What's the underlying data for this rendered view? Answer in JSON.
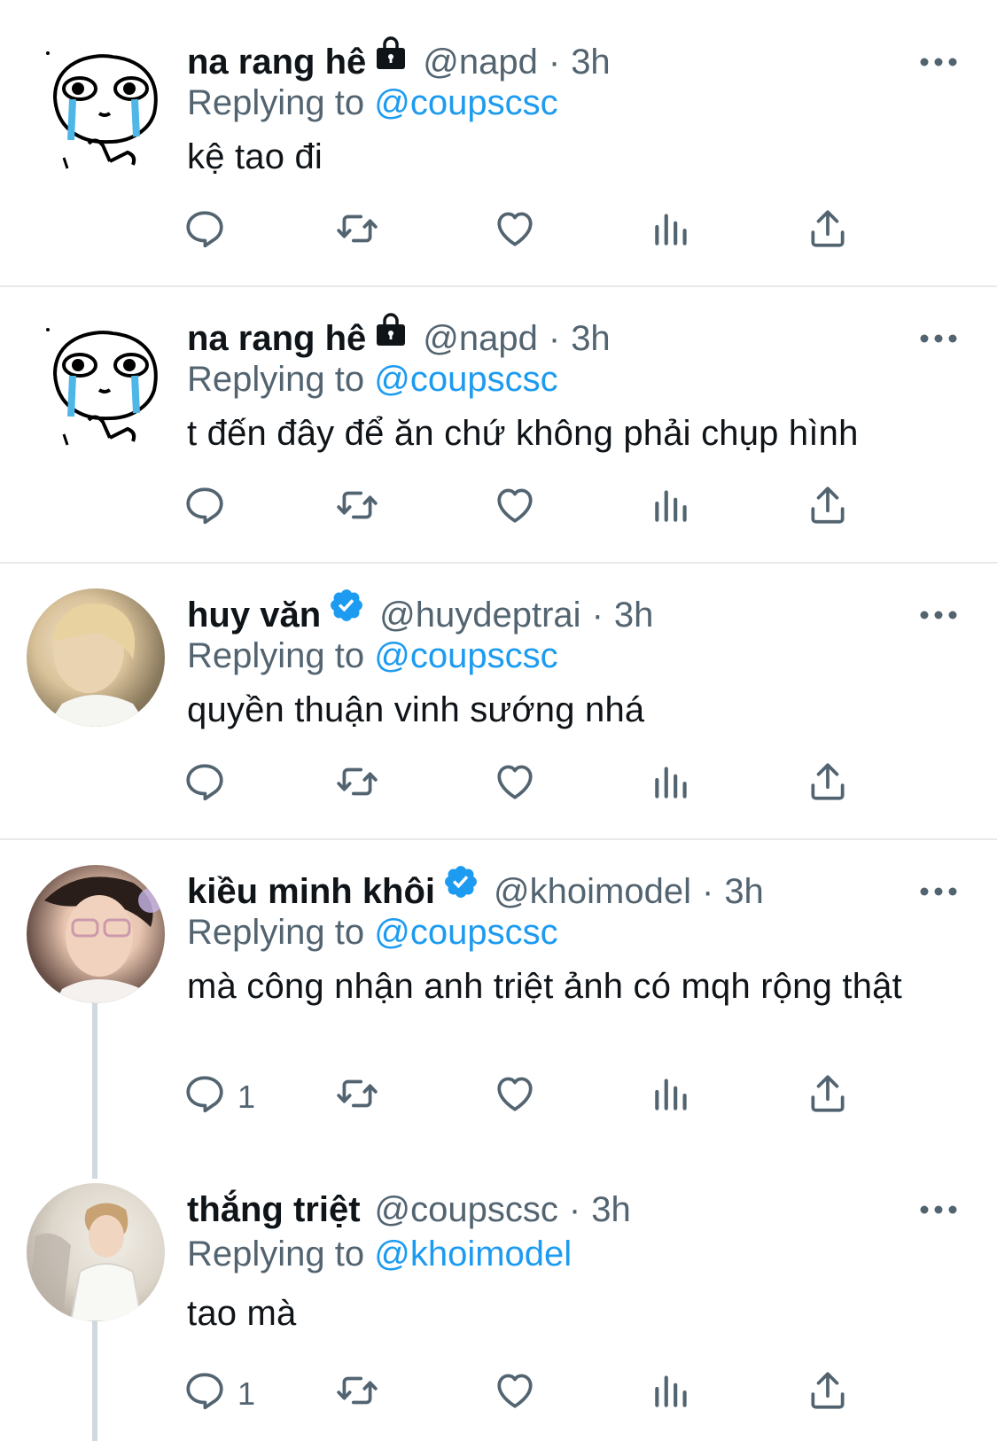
{
  "reply_prefix": "Replying to",
  "colors": {
    "accent": "#1d9bf0",
    "muted": "#536471",
    "text": "#0f1419",
    "verified": "#1d9bf0",
    "divider": "#e6e9ec"
  },
  "action_icons": [
    "reply-icon",
    "retweet-icon",
    "like-icon",
    "analytics-icon",
    "share-icon"
  ],
  "tweets": [
    {
      "name": "na rang hê",
      "badge": "lock-icon",
      "handle": "@napd",
      "sep": "·",
      "time": "3h",
      "reply_to": "@coupscsc",
      "text": "kệ tao đi",
      "reply_count": ""
    },
    {
      "name": "na rang hê",
      "badge": "lock-icon",
      "handle": "@napd",
      "sep": "·",
      "time": "3h",
      "reply_to": "@coupscsc",
      "text": "t đến đây để ăn chứ không phải chụp hình",
      "reply_count": ""
    },
    {
      "name": "huy văn",
      "badge": "verified-icon",
      "handle": "@huydeptrai",
      "sep": "·",
      "time": "3h",
      "reply_to": "@coupscsc",
      "text": "quyền thuận vinh sướng nhá",
      "reply_count": ""
    },
    {
      "name": "kiều minh khôi",
      "badge": "verified-icon",
      "handle": "@khoimodel",
      "sep": "·",
      "time": "3h",
      "reply_to": "@coupscsc",
      "text": "mà công nhận anh triệt ảnh có mqh rộng thật",
      "reply_count": "1"
    },
    {
      "name": "thắng triệt",
      "badge": "",
      "handle": "@coupscsc",
      "sep": "·",
      "time": "3h",
      "reply_to": "@khoimodel",
      "text": "tao mà",
      "reply_count": "1"
    }
  ]
}
